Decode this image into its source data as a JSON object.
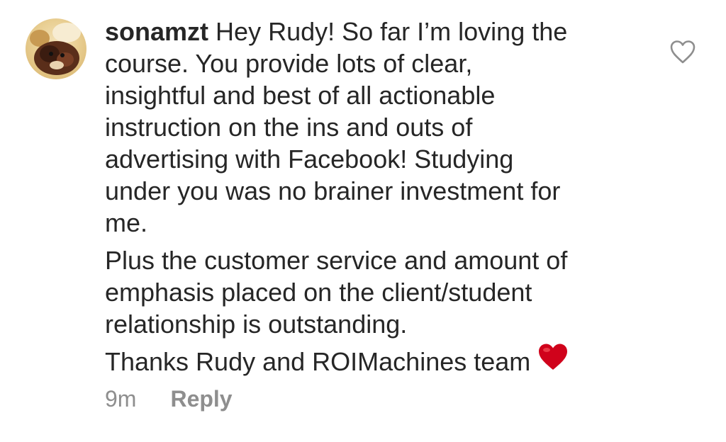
{
  "comment": {
    "username": "sonamzt",
    "paragraph1_lines": [
      "Hey Rudy! So far I’m loving the",
      "course. You provide lots of clear,",
      "insightful and best of all actionable",
      "instruction on the ins and outs of",
      "advertising with Facebook! Studying",
      "under you was no brainer investment for",
      "me."
    ],
    "paragraph2_lines": [
      "Plus the customer service and amount of",
      "emphasis placed on the client/student",
      "relationship is outstanding."
    ],
    "paragraph3_text": "Thanks Rudy and ROIMachines team",
    "time": "9m",
    "reply_label": "Reply",
    "heart_color": "#d0021b",
    "like_icon": "heart-outline-icon"
  }
}
